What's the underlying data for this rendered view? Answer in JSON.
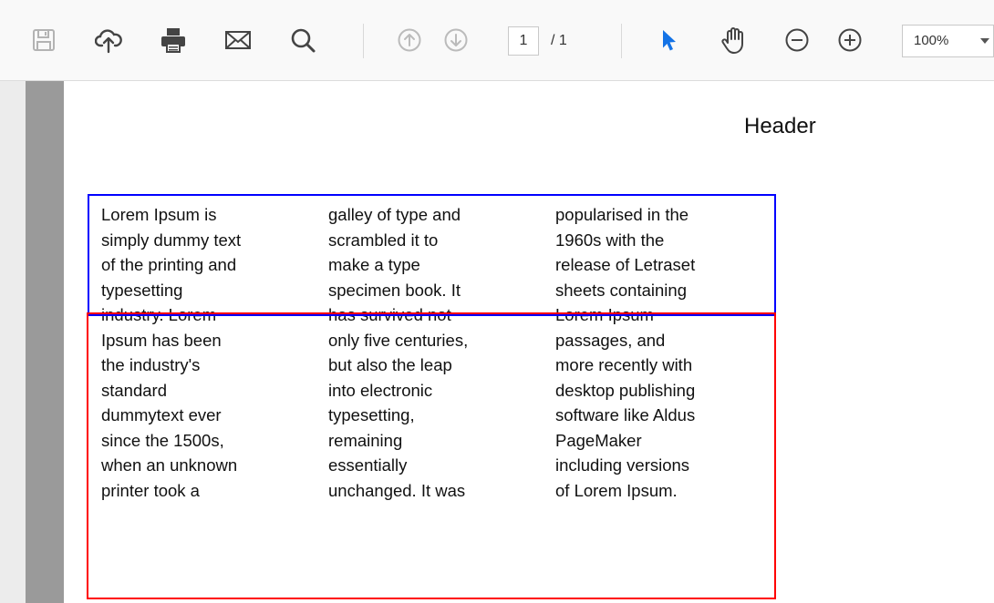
{
  "toolbar": {
    "buttons": [
      {
        "icon": "save-icon",
        "enabled": false
      },
      {
        "icon": "upload-cloud-icon",
        "enabled": true
      },
      {
        "icon": "print-icon",
        "enabled": true
      },
      {
        "icon": "email-icon",
        "enabled": true
      },
      {
        "icon": "search-icon",
        "enabled": true
      },
      {
        "icon": "previous-page-icon",
        "enabled": false
      },
      {
        "icon": "next-page-icon",
        "enabled": false
      },
      {
        "icon": "select-arrow-icon",
        "enabled": true,
        "color": "#1473e6"
      },
      {
        "icon": "hand-tool-icon",
        "enabled": true
      },
      {
        "icon": "zoom-out-icon",
        "enabled": true
      },
      {
        "icon": "zoom-in-icon",
        "enabled": true
      }
    ],
    "page_current": "1",
    "page_total": "/ 1",
    "zoom_value": "100%"
  },
  "document": {
    "header": "Header",
    "columns": [
      "Lorem Ipsum is\nsimply dummy text\nof the printing and\ntypesetting\nindustry. Lorem\nIpsum has been\nthe industry's\nstandard\ndummytext ever\nsince the 1500s,\nwhen an unknown\nprinter took a",
      "galley of type and\nscrambled it to\nmake a type\nspecimen book. It\nhas survived not\nonly five centuries,\nbut also the leap\ninto electronic\ntypesetting,\nremaining\nessentially\nunchanged. It was",
      "popularised in the\n1960s with the\nrelease of Letraset\nsheets containing\nLorem Ipsum\npassages, and\nmore recently with\ndesktop publishing\nsoftware like Aldus\nPageMaker\nincluding versions\nof Lorem Ipsum."
    ],
    "highlight_colors": {
      "top_box": "#0000ff",
      "bottom_box": "#ff0000"
    }
  }
}
